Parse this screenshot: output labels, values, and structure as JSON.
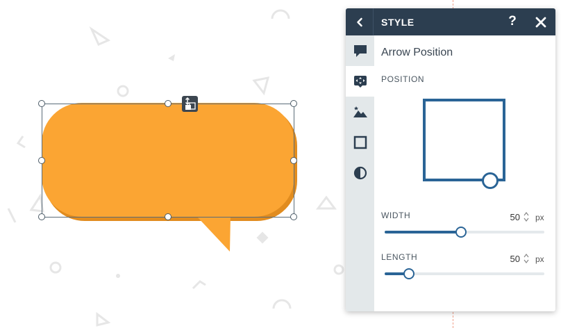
{
  "panel": {
    "title": "STYLE",
    "help_label": "?",
    "section_title": "Arrow Position",
    "position_label": "POSITION",
    "sidebar_tabs": [
      {
        "icon": "speech-bubble-icon",
        "active": false
      },
      {
        "icon": "move-arrows-icon",
        "active": true
      },
      {
        "icon": "image-icon",
        "active": false
      },
      {
        "icon": "square-outline-icon",
        "active": false
      },
      {
        "icon": "contrast-icon",
        "active": false
      }
    ]
  },
  "width_control": {
    "label": "WIDTH",
    "value": "50",
    "unit": "px",
    "fraction": 0.48
  },
  "length_control": {
    "label": "LENGTH",
    "value": "50",
    "unit": "px",
    "fraction": 0.15
  },
  "colors": {
    "bubble": "#fba533",
    "bubble_shadow": "#e18c1f",
    "panel_header": "#2c3e50",
    "accent": "#2a6496"
  }
}
